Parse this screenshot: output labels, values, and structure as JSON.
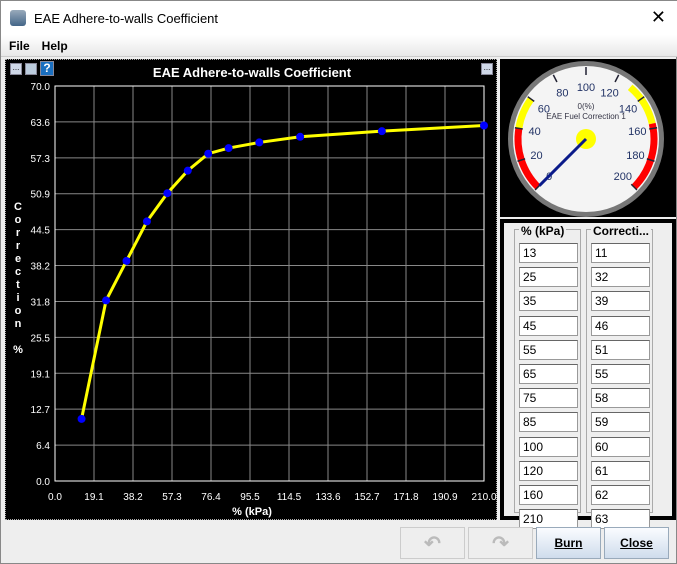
{
  "window": {
    "title": "EAE Adhere-to-walls Coefficient",
    "close": "✕"
  },
  "menu": {
    "file": "File",
    "help": "Help"
  },
  "chart_data": {
    "type": "line",
    "title": "EAE Adhere-to-walls Coefficient",
    "xlabel": "% (kPa)",
    "ylabel": "Correction %",
    "xlim": [
      0,
      210
    ],
    "ylim": [
      0,
      70
    ],
    "xticks": [
      "0.0",
      "19.1",
      "38.2",
      "57.3",
      "76.4",
      "95.5",
      "114.5",
      "133.6",
      "152.7",
      "171.8",
      "190.9",
      "210.0"
    ],
    "yticks": [
      "0.0",
      "6.4",
      "12.7",
      "19.1",
      "25.5",
      "31.8",
      "38.2",
      "44.5",
      "50.9",
      "57.3",
      "63.6",
      "70.0"
    ],
    "x": [
      13,
      25,
      35,
      45,
      55,
      65,
      75,
      85,
      100,
      120,
      160,
      210
    ],
    "y": [
      11,
      32,
      39,
      46,
      51,
      55,
      58,
      59,
      60,
      61,
      62,
      63
    ],
    "line_color": "#ffff00",
    "point_color": "#0000ff",
    "grid": true
  },
  "gauge": {
    "title": "EAE Fuel Correction 1",
    "value_text": "0(%)",
    "value": 0,
    "min": 0,
    "max": 200,
    "labels": [
      "0",
      "20",
      "40",
      "60",
      "80",
      "100",
      "120",
      "140",
      "160",
      "180",
      "200"
    ]
  },
  "table": {
    "headers": [
      "% (kPa)",
      "Correcti..."
    ],
    "col1": [
      "13",
      "25",
      "35",
      "45",
      "55",
      "65",
      "75",
      "85",
      "100",
      "120",
      "160",
      "210"
    ],
    "col2": [
      "11",
      "32",
      "39",
      "46",
      "51",
      "55",
      "58",
      "59",
      "60",
      "61",
      "62",
      "63"
    ]
  },
  "buttons": {
    "undo": "↶",
    "redo": "↷",
    "burn": "Burn",
    "close": "Close"
  },
  "toolbar": {
    "menu": "...",
    "help": "?",
    "menu_right": "..."
  }
}
